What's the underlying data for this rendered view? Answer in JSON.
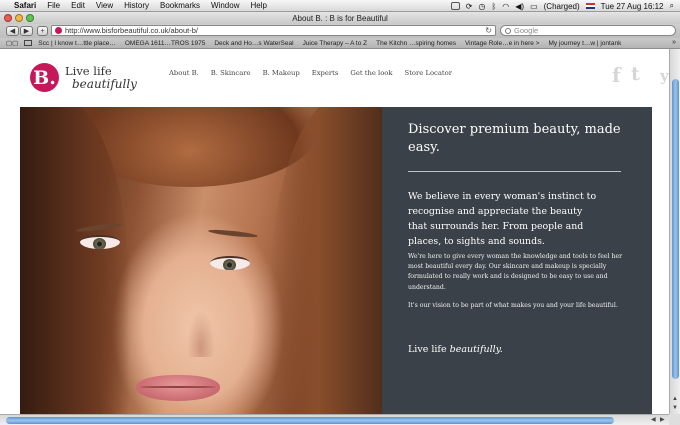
{
  "menubar": {
    "app_name": "Safari",
    "items": [
      "File",
      "Edit",
      "View",
      "History",
      "Bookmarks",
      "Window",
      "Help"
    ],
    "battery_status": "(Charged)",
    "clock": "Tue 27 Aug  16:12"
  },
  "window": {
    "title": "About B. : B is for Beautiful"
  },
  "toolbar": {
    "back_label": "◀",
    "forward_label": "▶",
    "add_label": "+",
    "url": "http://www.bisforbeautiful.co.uk/about-b/",
    "search_placeholder": "Google"
  },
  "bookmarks": {
    "items": [
      "Scc | I know t…ttle place…",
      "OMEGA 1611…TROS 1975",
      "Deck and Ho…s WaterSeal",
      "Juice Therapy – A to Z",
      "The Kitchn …spiring homes",
      "Vintage Role…e in here >",
      "My journey t…w | jontank"
    ],
    "more_label": "»"
  },
  "site": {
    "logo_mark": "B.",
    "logo_line1": "Live life",
    "logo_line2": "beautifully",
    "nav": [
      "About B.",
      "B. Skincare",
      "B. Makeup",
      "Experts",
      "Get the look",
      "Store Locator"
    ],
    "social": [
      "f",
      "t",
      "y"
    ]
  },
  "panel": {
    "title": "Discover premium beauty, made easy.",
    "lead": "We believe in every woman's instinct to recognise and appreciate the beauty that surrounds her. From people and places, to sights and sounds.",
    "body1": "We're here to give every woman the knowledge and tools to feel her most beautiful every day. Our skincare and makeup is specially formulated to really work and is designed to be easy to use and understand.",
    "body2": "It's our vision to be part of what makes you and your life beautiful.",
    "sign_plain": "Live life",
    "sign_italic": "beautifully."
  },
  "colors": {
    "brand": "#c4185a",
    "panel_bg": "#3b4148",
    "scroll_thumb": "#6fa1d6"
  }
}
